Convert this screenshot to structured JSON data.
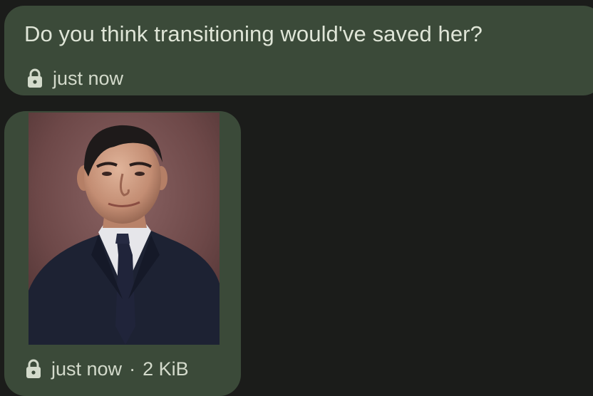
{
  "messages": [
    {
      "text": "Do you think transitioning would've saved her?",
      "status_icon": "lock-icon",
      "time": "just now"
    },
    {
      "attachment_type": "photo",
      "status_icon": "lock-icon",
      "time": "just now",
      "separator": "·",
      "size": "2 KiB"
    }
  ],
  "colors": {
    "background": "#1b1c1a",
    "bubble": "#3b4a39",
    "text": "#dfe5d7"
  }
}
